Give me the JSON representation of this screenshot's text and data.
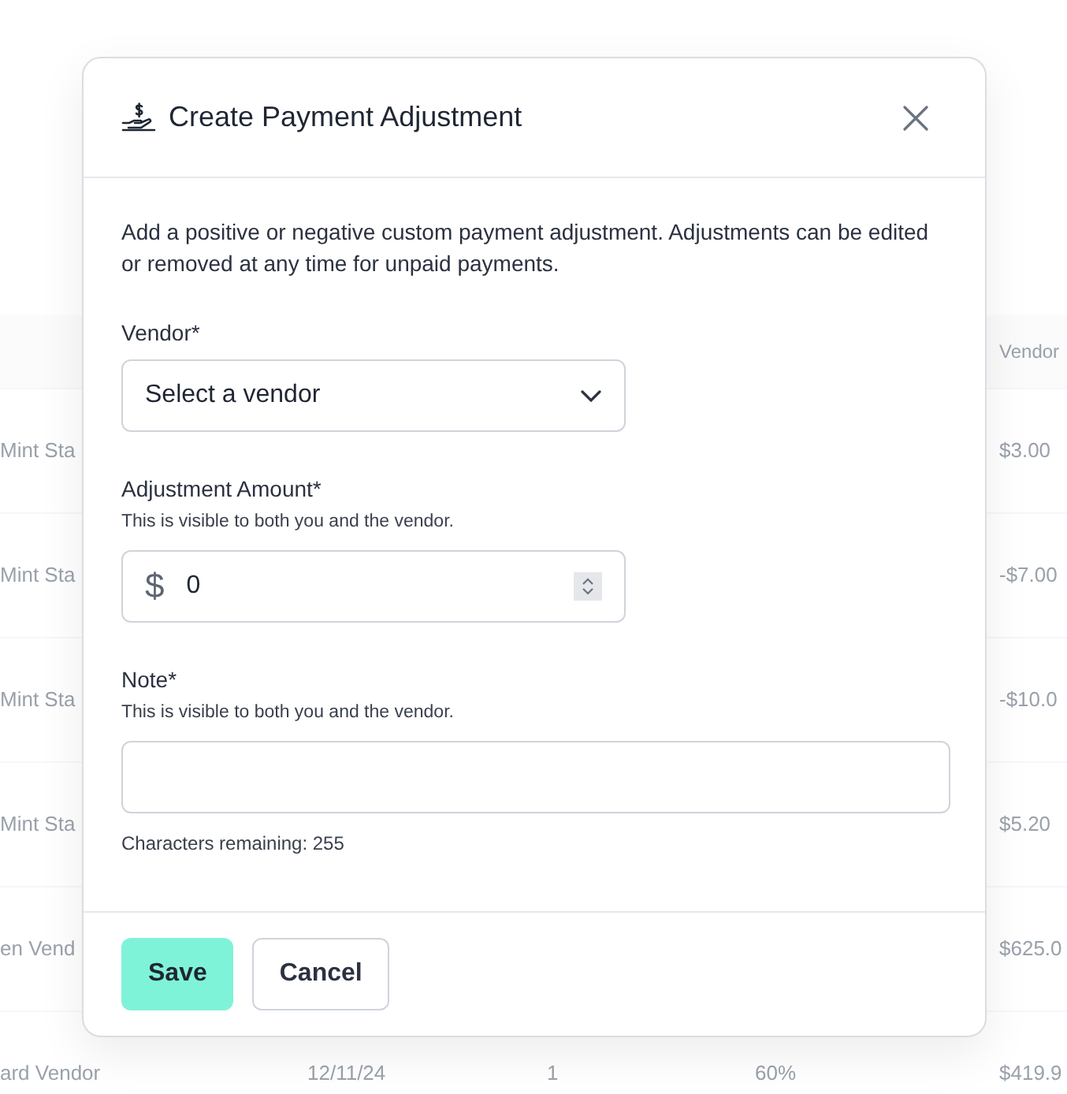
{
  "background_table": {
    "header": {
      "column_5": "Vendor"
    },
    "rows": [
      {
        "column_1": "Mint Sta",
        "column_5": "$3.00"
      },
      {
        "column_1": "Mint Sta",
        "column_5": "-$7.00"
      },
      {
        "column_1": "Mint Sta",
        "column_5": "-$10.0"
      },
      {
        "column_1": "Mint Sta",
        "column_5": "$5.20"
      },
      {
        "column_1": "en Vend",
        "column_5": "$625.0"
      },
      {
        "column_1": "ard Vendor",
        "column_2": "12/11/24",
        "column_3": "1",
        "column_4": "60%",
        "column_5": "$419.9"
      }
    ]
  },
  "dialog": {
    "title": "Create Payment Adjustment",
    "description": "Add a positive or negative custom payment adjustment. Adjustments can be edited or removed at any time for unpaid payments.",
    "fields": [
      {
        "kind": "select",
        "label": "Vendor*",
        "value": "Select a vendor"
      },
      {
        "kind": "amount",
        "label": "Adjustment Amount*",
        "hint": "This is visible to both you and the vendor.",
        "prefix": "$",
        "value": "0"
      },
      {
        "kind": "text",
        "label": "Note*",
        "hint": "This is visible to both you and the vendor.",
        "counter": "Characters remaining: 255"
      }
    ],
    "buttons": [
      {
        "label": "Save",
        "kind": "primary"
      },
      {
        "label": "Cancel",
        "kind": "secondary"
      }
    ]
  }
}
